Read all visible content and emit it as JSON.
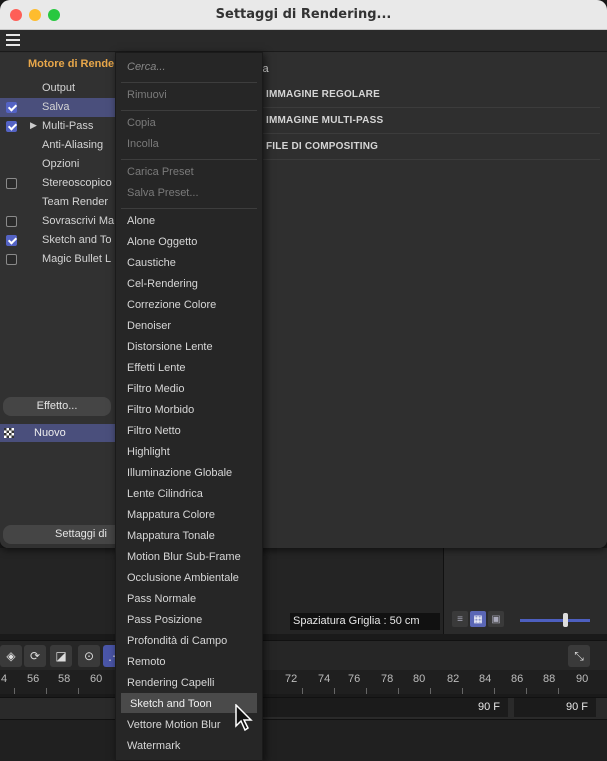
{
  "window": {
    "title": "Settaggi di Rendering..."
  },
  "left_pane": {
    "engine_label": "Motore di Rende",
    "items": [
      {
        "label": "Output",
        "checkbox": false,
        "checked": false,
        "selected": false
      },
      {
        "label": "Salva",
        "checkbox": true,
        "checked": true,
        "selected": true
      },
      {
        "label": "Multi-Pass",
        "checkbox": true,
        "checked": true,
        "selected": false,
        "expander": "▶"
      },
      {
        "label": "Anti-Aliasing",
        "checkbox": false,
        "checked": false,
        "selected": false
      },
      {
        "label": "Opzioni",
        "checkbox": false,
        "checked": false,
        "selected": false
      },
      {
        "label": "Stereoscopico",
        "checkbox": true,
        "checked": false,
        "selected": false
      },
      {
        "label": "Team Render",
        "checkbox": false,
        "checked": false,
        "selected": false
      },
      {
        "label": "Sovrascrivi Ma",
        "checkbox": true,
        "checked": false,
        "selected": false
      },
      {
        "label": "Sketch and To",
        "checkbox": true,
        "checked": true,
        "selected": false
      },
      {
        "label": "Magic Bullet L",
        "checkbox": true,
        "checked": false,
        "selected": false
      }
    ],
    "effect_button": "Effetto...",
    "new_label": "Nuovo",
    "settings_button": "Settaggi di"
  },
  "right_pane": {
    "title_fragment": "va",
    "sections": [
      "IMMAGINE REGOLARE",
      "IMMAGINE MULTI-PASS",
      "FILE DI COMPOSITING"
    ]
  },
  "context_menu": {
    "search_placeholder": "Cerca...",
    "group1": [
      "Rimuovi"
    ],
    "group2": [
      "Copia",
      "Incolla"
    ],
    "group3": [
      "Carica Preset",
      "Salva Preset..."
    ],
    "effects": [
      "Alone",
      "Alone Oggetto",
      "Caustiche",
      "Cel-Rendering",
      "Correzione Colore",
      "Denoiser",
      "Distorsione Lente",
      "Effetti Lente",
      "Filtro Medio",
      "Filtro Morbido",
      "Filtro Netto",
      "Highlight",
      "Illuminazione Globale",
      "Lente Cilindrica",
      "Mappatura Colore",
      "Mappatura Tonale",
      "Motion Blur Sub-Frame",
      "Occlusione Ambientale",
      "Pass Normale",
      "Pass Posizione",
      "Profondità di Campo",
      "Remoto",
      "Rendering Capelli",
      "Sketch and Toon",
      "Vettore Motion Blur",
      "Watermark"
    ],
    "highlighted": "Sketch and Toon"
  },
  "viewport": {
    "grid_spacing": "Spaziatura Griglia : 50 cm"
  },
  "timeline": {
    "ruler_left": [
      "4",
      "56",
      "58",
      "60"
    ],
    "ruler_right": [
      "72",
      "74",
      "76",
      "78",
      "80",
      "82",
      "84",
      "86",
      "88",
      "90"
    ],
    "end_frame": "90 F",
    "max_frame": "90 F"
  },
  "colors": {
    "accent": "#5463c4",
    "selection": "#4a4f7c",
    "engine_label": "#e8a74a"
  }
}
